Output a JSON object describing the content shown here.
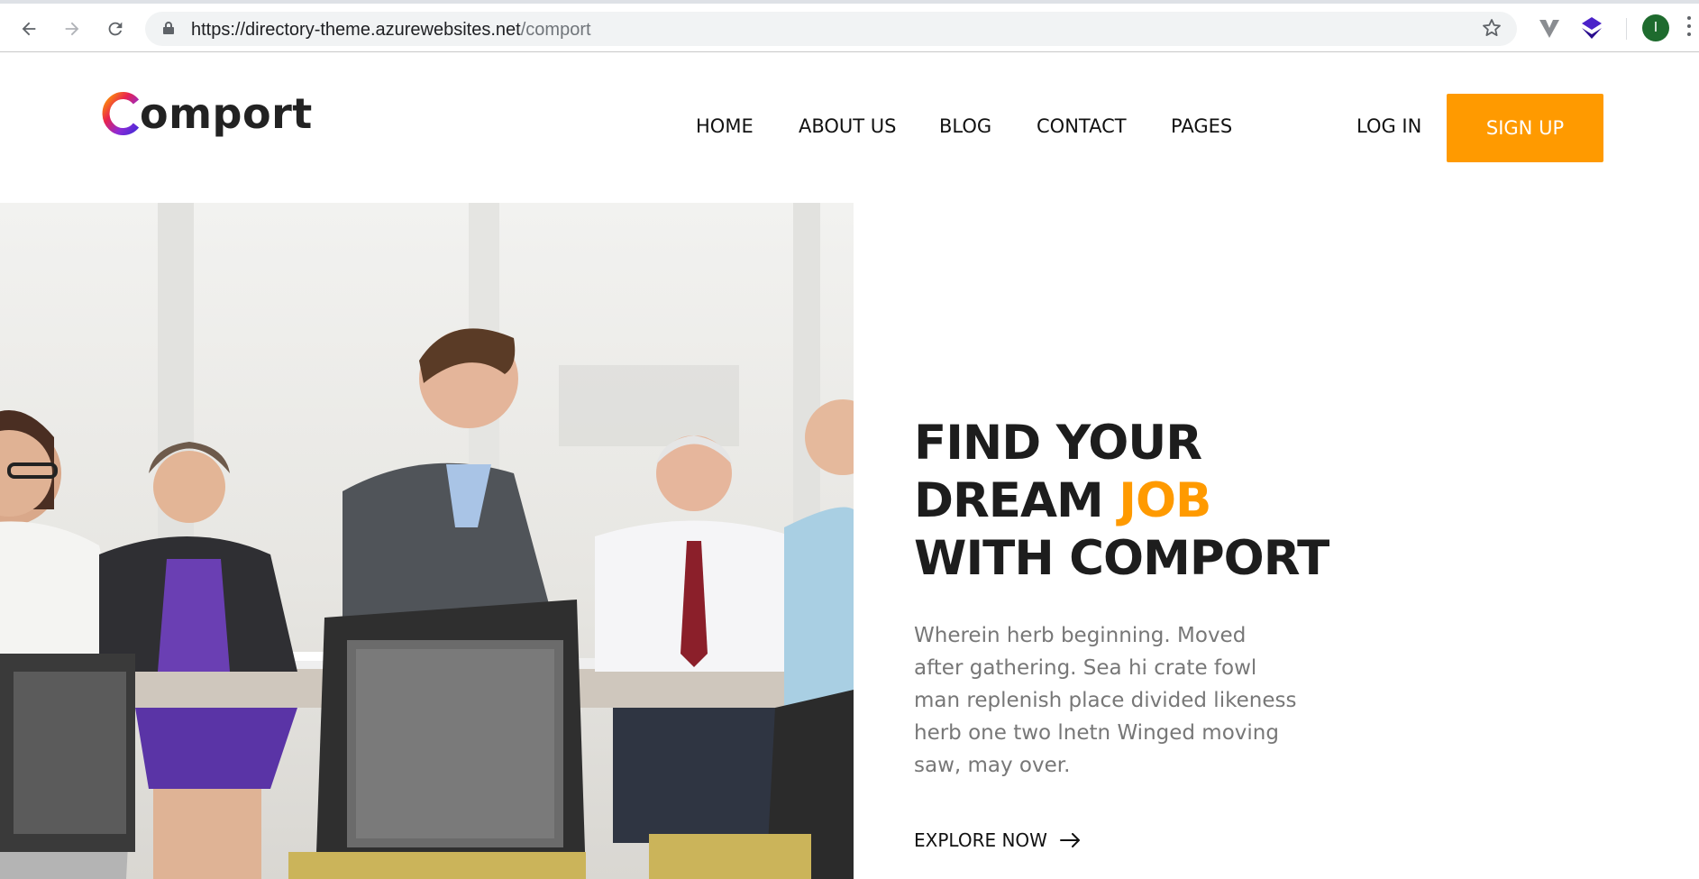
{
  "browser": {
    "url_host": "https://directory-theme.azurewebsites.net",
    "url_path": "/comport",
    "profile_initial": "I",
    "icons": [
      "back-icon",
      "forward-icon",
      "reload-icon",
      "lock-icon",
      "bookmark-star-icon",
      "extension-v-icon",
      "extension-cube-icon",
      "profile-avatar",
      "menu-kebab-icon"
    ]
  },
  "site": {
    "logo_letter": "C",
    "logo_rest": "omport",
    "nav": [
      "HOME",
      "ABOUT US",
      "BLOG",
      "CONTACT",
      "PAGES"
    ],
    "login_label": "LOG IN",
    "signup_label": "SIGN UP",
    "accent_color": "#ff9a00"
  },
  "hero": {
    "line1": "FIND YOUR",
    "line2_pre": "DREAM ",
    "line2_highlight": "JOB",
    "line3": "WITH COMPORT",
    "paragraph": "Wherein herb beginning. Moved after gathering. Sea hi crate fowl man replenish place divided likeness herb one two lnetn Winged moving saw, may over.",
    "cta_label": "EXPLORE NOW",
    "image_alt": "Business team smiling around a meeting table"
  }
}
